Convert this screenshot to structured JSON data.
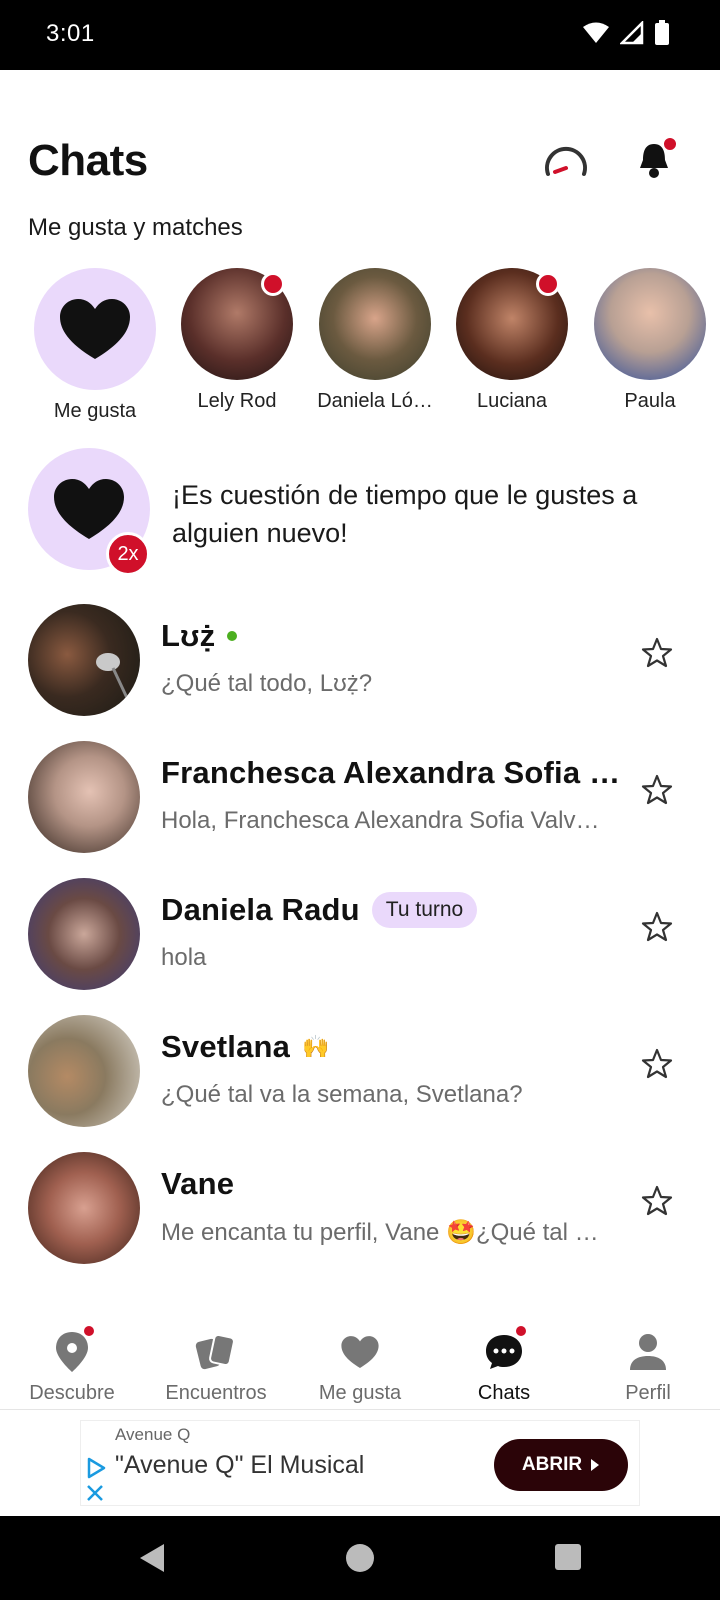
{
  "status_bar": {
    "time": "3:01"
  },
  "header": {
    "title": "Chats"
  },
  "likes_section": {
    "title": "Me gusta y matches",
    "me_gusta_label": "Me gusta",
    "profiles": [
      {
        "name": "Lely Rod",
        "has_dot": true
      },
      {
        "name": "Daniela Ló…",
        "has_dot": false
      },
      {
        "name": "Luciana",
        "has_dot": true
      },
      {
        "name": "Paula",
        "has_dot": false
      }
    ]
  },
  "promo": {
    "badge": "2x",
    "text": "¡Es cuestión de tiempo que le gustes a alguien nuevo!"
  },
  "chats": [
    {
      "name": "Lʊẓ̇",
      "message": "¿Qué tal todo, Lʊẓ̇?",
      "online": true
    },
    {
      "name": "Franchesca Alexandra Sofia …",
      "message": "Hola, Franchesca Alexandra Sofia Valv…"
    },
    {
      "name": "Daniela Radu",
      "message": "hola",
      "badge": "Tu turno"
    },
    {
      "name": "Svetlana",
      "name_emoji": "🙌",
      "message": "¿Qué tal va la semana, Svetlana?"
    },
    {
      "name": "Vane",
      "message": "Me encanta tu perfil, Vane 🤩¿Qué tal …"
    }
  ],
  "bottom_nav": {
    "items": [
      {
        "label": "Descubre"
      },
      {
        "label": "Encuentros"
      },
      {
        "label": "Me gusta"
      },
      {
        "label": "Chats"
      },
      {
        "label": "Perfil"
      }
    ],
    "active": "Chats"
  },
  "ad": {
    "advertiser": "Avenue Q",
    "title": "\"Avenue Q\" El Musical",
    "cta": "ABRIR"
  },
  "colors": {
    "accent_red": "#d0102a",
    "lavender": "#ead9fb",
    "online_green": "#4caf20",
    "cta_dark": "#2b0408"
  }
}
